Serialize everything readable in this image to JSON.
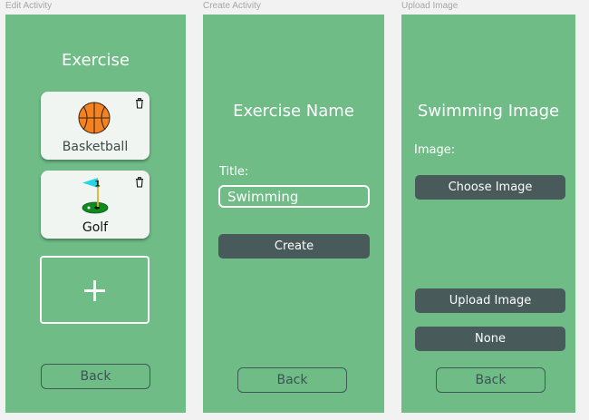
{
  "frames": {
    "edit_activity": {
      "label": "Edit Activity",
      "title": "Exercise",
      "cards": [
        {
          "label": "Basketball",
          "icon": "basketball-icon"
        },
        {
          "label": "Golf",
          "icon": "golf-icon"
        }
      ],
      "add_icon": "plus-icon",
      "delete_icon": "trash-icon",
      "back_label": "Back"
    },
    "create_activity": {
      "label": "Create Activity",
      "title": "Exercise Name",
      "field_label": "Title:",
      "title_value": "Swimming",
      "create_label": "Create",
      "back_label": "Back"
    },
    "upload_image": {
      "label": "Upload Image",
      "title": "Swimming Image",
      "image_label": "Image:",
      "choose_label": "Choose Image",
      "upload_label": "Upload Image",
      "none_label": "None",
      "back_label": "Back"
    }
  },
  "colors": {
    "frame_bg": "#6fbc87",
    "button_dark": "#485a59",
    "card_bg": "#f1f5f2",
    "canvas_bg": "#f2f2f2"
  }
}
